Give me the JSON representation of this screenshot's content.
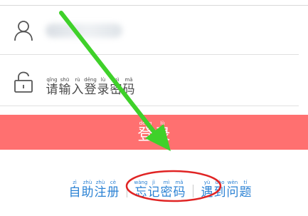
{
  "username_row": {
    "icon": "user-icon"
  },
  "password_row": {
    "icon": "lock-icon",
    "placeholder": [
      {
        "pinyin": "qǐng",
        "hanzi": "请"
      },
      {
        "pinyin": "shū",
        "hanzi": "输"
      },
      {
        "pinyin": "rù",
        "hanzi": "入"
      },
      {
        "pinyin": "dēng",
        "hanzi": "登"
      },
      {
        "pinyin": "lù",
        "hanzi": "录"
      },
      {
        "pinyin": "mì",
        "hanzi": "密"
      },
      {
        "pinyin": "mǎ",
        "hanzi": "码"
      }
    ]
  },
  "login_button": {
    "chars": [
      {
        "pinyin": "dēng",
        "hanzi": "登"
      },
      {
        "pinyin": "lù",
        "hanzi": "录"
      }
    ]
  },
  "links": {
    "register": [
      {
        "pinyin": "zì",
        "hanzi": "自"
      },
      {
        "pinyin": "zhù",
        "hanzi": "助"
      },
      {
        "pinyin": "zhù",
        "hanzi": "注"
      },
      {
        "pinyin": "cè",
        "hanzi": "册"
      }
    ],
    "forgot_password": [
      {
        "pinyin": "wàng",
        "hanzi": "忘"
      },
      {
        "pinyin": "jì",
        "hanzi": "记"
      },
      {
        "pinyin": "mì",
        "hanzi": "密"
      },
      {
        "pinyin": "mǎ",
        "hanzi": "码"
      }
    ],
    "problems": [
      {
        "pinyin": "yù",
        "hanzi": "遇"
      },
      {
        "pinyin": "dào",
        "hanzi": "到"
      },
      {
        "pinyin": "wèn",
        "hanzi": "问"
      },
      {
        "pinyin": "tí",
        "hanzi": "题"
      }
    ]
  },
  "colors": {
    "button": "#ff7070",
    "link": "#2b82d4",
    "arrow": "#3fd12a",
    "circle": "#e02424"
  }
}
